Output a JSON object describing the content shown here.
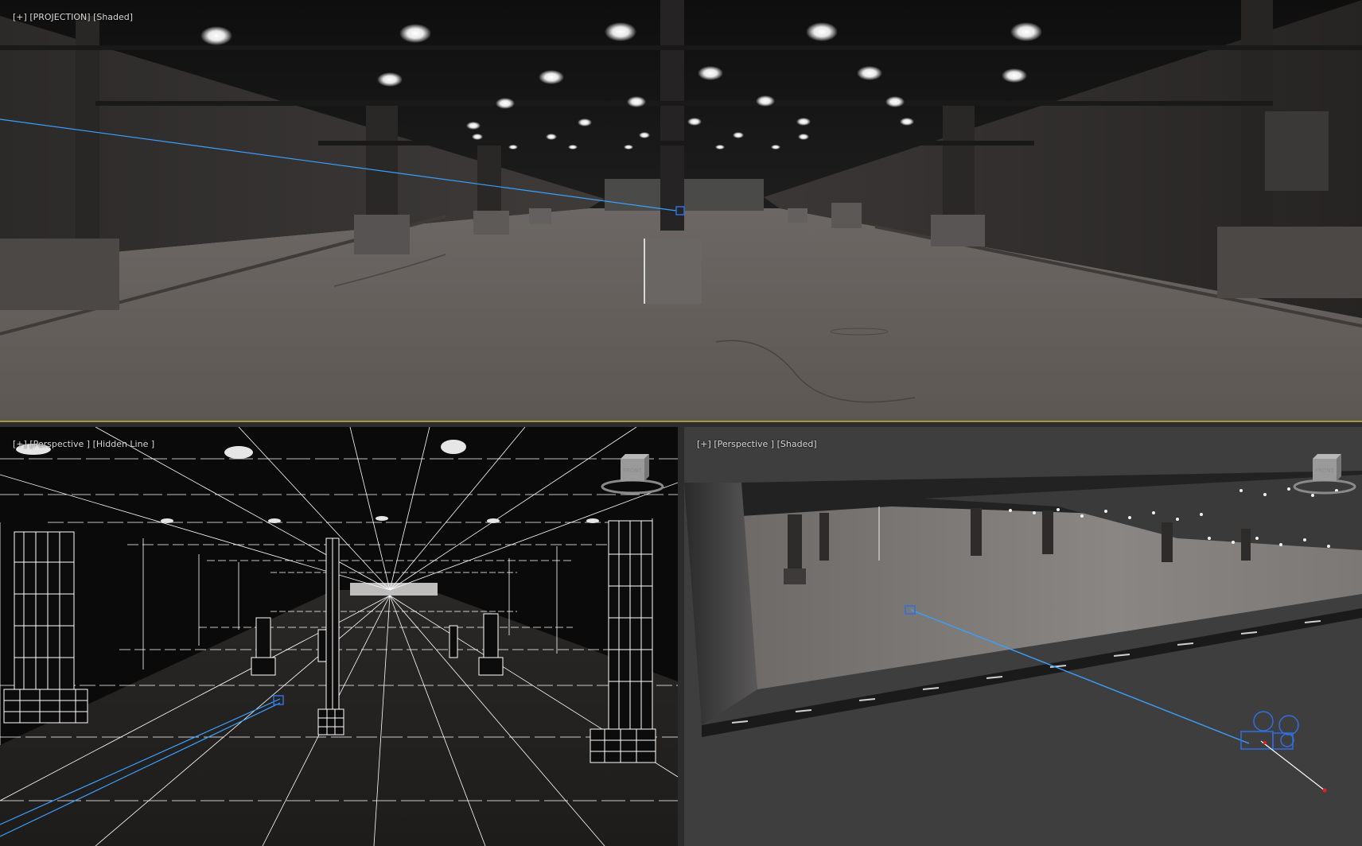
{
  "app": {
    "name": "3D viewport layout"
  },
  "viewports": {
    "top": {
      "label_plus": "[+]",
      "label_view": "[PROJECTION]",
      "label_shading": "[Shaded]",
      "active": true
    },
    "bottom_left": {
      "label_plus": "[+]",
      "label_view": "[Perspective ]",
      "label_shading": "[Hidden Line ]",
      "viewcube_face": "FRONT"
    },
    "bottom_right": {
      "label_plus": "[+]",
      "label_view": "[Perspective ]",
      "label_shading": "[Shaded]",
      "viewcube_face": "FRONT"
    }
  },
  "colors": {
    "active_border": "#a59a3a",
    "camera_line": "#3aa0ff",
    "camera_gizmo": "#2f6fe0",
    "target_dot": "#e02020",
    "wire": "#ffffff"
  },
  "icons": [
    "viewcube-icon",
    "camera-icon",
    "camera-target-icon"
  ]
}
